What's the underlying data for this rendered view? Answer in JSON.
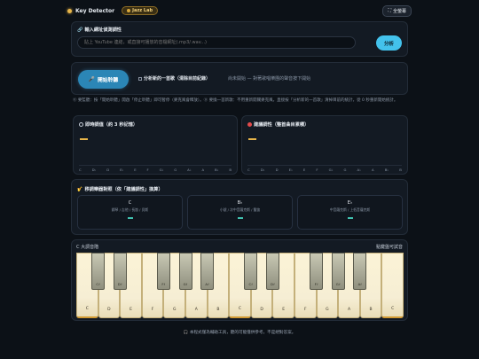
{
  "header": {
    "app_title": "Key Detector",
    "badge": "Jazz Lab",
    "fullscreen_label": "全螢幕"
  },
  "url_section": {
    "title": "輸入網址偵測調性",
    "placeholder": "貼上 YouTube 連結，或直接可播放的音檔網址(.mp3/.wav...)",
    "analyze_label": "分析"
  },
  "controls": {
    "start_label": "開始聆聽",
    "analyze_song_label": "分析新的一首歌（清除目前紀錄）",
    "status": "尚未開始 — 對著歌唱樂團的聲音按下開始"
  },
  "help_text": "⓪ 要監聽：按「開始聆聽」開啟「停止聆聽」即可暫停（麥克風會釋放）。⓪ 要換一首新歌：不用重新開關麥克風，直接按「分析新的一首歌」清掉目前的統計，從 0 秒重新開始統計。",
  "instant": {
    "title": "即時調值（約 3 秒記憶）",
    "value": "—"
  },
  "suggested": {
    "title": "建議調性（整首曲目累積）",
    "value": "—"
  },
  "note_names": [
    "C",
    "D♭",
    "D",
    "E♭",
    "E",
    "F",
    "G♭",
    "G",
    "A♭",
    "A",
    "B♭",
    "B"
  ],
  "transpose": {
    "title": "移調樂器對照（依「建議調性」換算）",
    "boxes": [
      {
        "key": "C",
        "sub": "鋼琴 / 吉他 / 長笛 / 貝斯",
        "value": "—"
      },
      {
        "key": "B♭",
        "sub": "小號 / 次中音薩克斯 / 豎笛",
        "value": "—"
      },
      {
        "key": "E♭",
        "sub": "中音薩克斯 / 上低音薩克斯",
        "value": "—"
      }
    ]
  },
  "piano": {
    "left_label": "C 大調音階",
    "right_label": "點鍵盤可試音",
    "white_keys": [
      "C",
      "D",
      "E",
      "F",
      "G",
      "A",
      "B",
      "C",
      "D",
      "E",
      "F",
      "G",
      "A",
      "B",
      "C"
    ],
    "black_keys": [
      "C♯",
      "D♯",
      "F♯",
      "G♯",
      "A♯",
      "C♯",
      "D♯",
      "F♯",
      "G♯",
      "A♯"
    ]
  },
  "footer": "本程式僅為輔助工具，聽的可能僅供參考，不是絕對答案。"
}
